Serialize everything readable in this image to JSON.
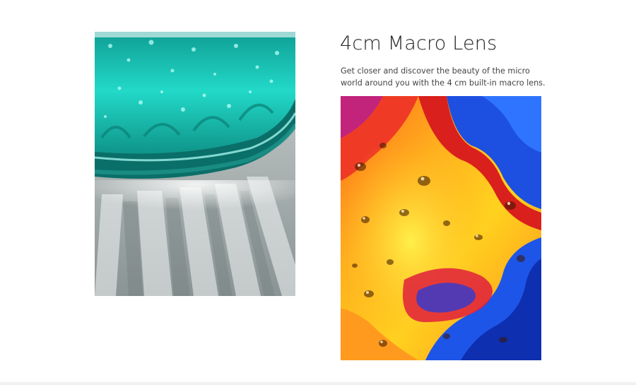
{
  "feature": {
    "title": "4cm Macro Lens",
    "description": "Get closer and discover the beauty of the micro world around you with the 4 cm built-in macro lens."
  },
  "images": [
    {
      "name": "glass-macro-photo",
      "subject": "teal glass edge with water droplets and light refraction"
    },
    {
      "name": "swirl-macro-photo",
      "subject": "colorful orange and blue swirl with droplets"
    }
  ],
  "colors": {
    "background": "#ffffff",
    "heading": "#222222",
    "body_text": "#444444",
    "teal": "#1fd6c4",
    "orange": "#f7931e",
    "blue": "#1e5ee0"
  }
}
